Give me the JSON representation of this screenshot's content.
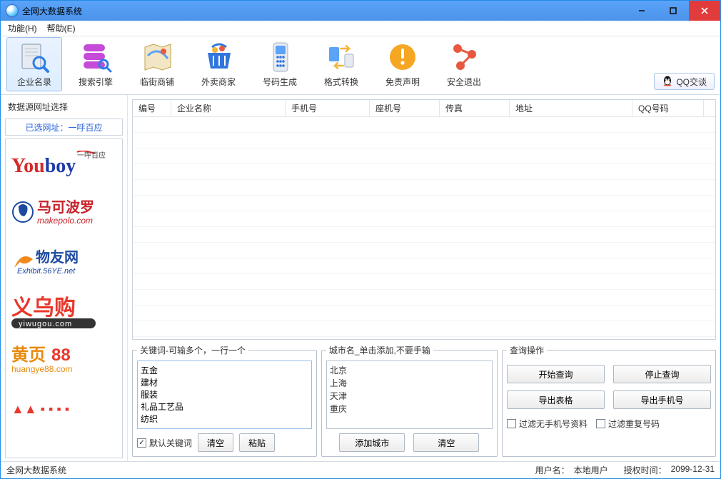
{
  "window": {
    "title": "全网大数据系统"
  },
  "menubar": {
    "function": "功能(H)",
    "help": "帮助(E)"
  },
  "toolbar": {
    "items": [
      {
        "label": "企业名录"
      },
      {
        "label": "搜索引擎"
      },
      {
        "label": "临街商铺"
      },
      {
        "label": "外卖商家"
      },
      {
        "label": "号码生成"
      },
      {
        "label": "格式转换"
      },
      {
        "label": "免责声明"
      },
      {
        "label": "安全退出"
      }
    ],
    "qq_btn": "QQ交谈"
  },
  "sidebar": {
    "title": "数据源网址选择",
    "chosen_label": "已选网址：一呼百应",
    "sources": [
      "Youboy 一呼百应",
      "马可波罗 makepolo.com",
      "物友网 Exhibit.56YE.net",
      "义乌购 yiwugou.com",
      "黄页88 huangye88.com"
    ]
  },
  "table": {
    "columns": [
      "编号",
      "企业名称",
      "手机号",
      "座机号",
      "传真",
      "地址",
      "QQ号码"
    ],
    "widths": [
      54,
      160,
      118,
      98,
      98,
      172,
      100
    ]
  },
  "keywords": {
    "legend": "关键词-可输多个，一行一个",
    "text": "五金\n建材\n服装\n礼品工艺品\n纺织",
    "default_cb": "默认关键词",
    "default_checked": true,
    "clear": "清空",
    "paste": "粘贴"
  },
  "cities": {
    "legend": "城市名_单击添加,不要手输",
    "items": [
      "北京",
      "上海",
      "天津",
      "重庆"
    ],
    "add": "添加城市",
    "clear": "清空"
  },
  "query": {
    "legend": "查询操作",
    "start": "开始查询",
    "stop": "停止查询",
    "export_table": "导出表格",
    "export_mobile": "导出手机号",
    "filter_no_mobile": "过滤无手机号资料",
    "filter_dup": "过滤重复号码"
  },
  "status": {
    "app": "全网大数据系统",
    "user_label": "用户名：",
    "user_value": "本地用户",
    "auth_label": "授权时间：",
    "auth_value": "2099-12-31"
  }
}
